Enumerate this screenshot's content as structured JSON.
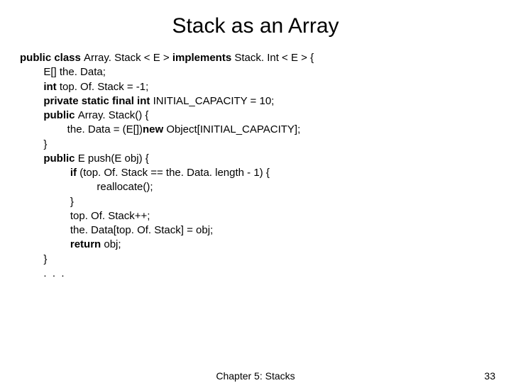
{
  "title": "Stack as an Array",
  "code": {
    "l1a": "public class ",
    "l1b": "Array. Stack < E > ",
    "l1c": "implements ",
    "l1d": "Stack. Int < E > {",
    "l2": "        E[] the. Data;",
    "l3a": "        ",
    "l3b": "int ",
    "l3c": "top. Of. Stack = -1;",
    "l4a": "        ",
    "l4b": "private static final int ",
    "l4c": "INITIAL_CAPACITY = 10;",
    "l5a": "        ",
    "l5b": "public ",
    "l5c": "Array. Stack() {",
    "l6a": "                the. Data = (E[])",
    "l6b": "new ",
    "l6c": "Object[INITIAL_CAPACITY];",
    "l7": "        }",
    "l8a": "        ",
    "l8b": "public ",
    "l8c": "E push(E obj) {",
    "l9a": "                 ",
    "l9b": "if ",
    "l9c": "(top. Of. Stack == the. Data. length - 1) {",
    "l10": "                          reallocate();",
    "l11": "                 }",
    "l12": "                 top. Of. Stack++;",
    "l13": "                 the. Data[top. Of. Stack] = obj;",
    "l14a": "                 ",
    "l14b": "return ",
    "l14c": "obj;",
    "l15": "        }",
    "l16": "        .  .  ."
  },
  "footer": {
    "chapter": "Chapter 5: Stacks",
    "page": "33"
  }
}
